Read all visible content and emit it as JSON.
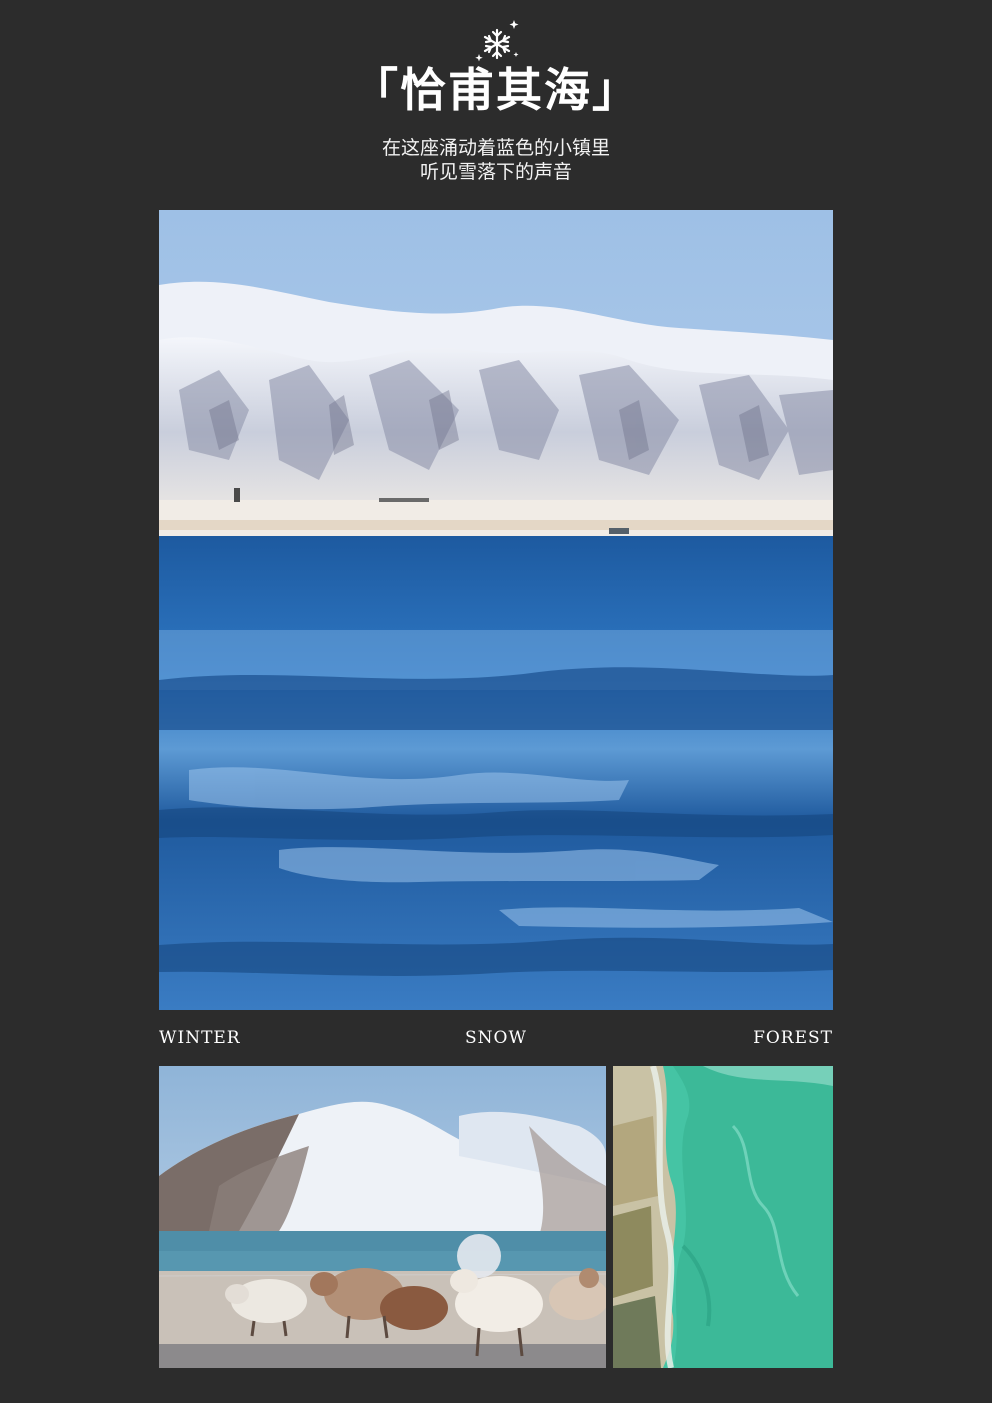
{
  "header": {
    "title": "「恰甫其海」",
    "subtitle_line1": "在这座涌动着蓝色的小镇里",
    "subtitle_line2": "听见雪落下的声音",
    "icon": "snowflake-icon"
  },
  "labels": {
    "left": "WINTER",
    "center": "SNOW",
    "right": "FOREST"
  },
  "colors": {
    "background": "#2c2c2c",
    "text": "#ffffff",
    "sky": "#a9c6e6",
    "lake": "#2a6fb5",
    "turquoise": "#3fbf9e"
  }
}
